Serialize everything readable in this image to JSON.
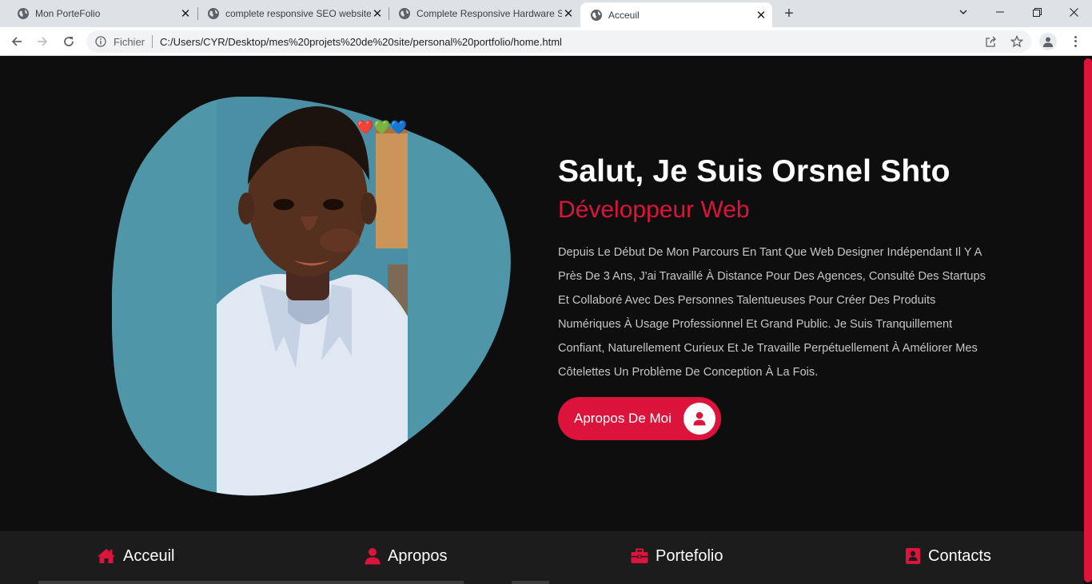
{
  "browser": {
    "tabs": [
      {
        "title": "Mon PorteFolio"
      },
      {
        "title": "complete responsive SEO website"
      },
      {
        "title": "Complete Responsive Hardware Store"
      },
      {
        "title": "Acceuil"
      }
    ],
    "address": {
      "protocol_label": "Fichier",
      "url": "C:/Users/CYR/Desktop/mes%20projets%20de%20site/personal%20portfolio/home.html"
    }
  },
  "hero": {
    "title": "Salut, Je Suis Orsnel Shto",
    "subtitle": "Développeur Web",
    "description": "Depuis Le Début De Mon Parcours En Tant Que Web Designer Indépendant Il Y A Près De 3 Ans, J'ai Travaillé À Distance Pour Des Agences, Consulté Des Startups Et Collaboré Avec Des Personnes Talentueuses Pour Créer Des Produits Numériques À Usage Professionnel Et Grand Public. Je Suis Tranquillement Confiant, Naturellement Curieux Et Je Travaille Perpétuellement À Améliorer Mes Côtelettes Un Problème De Conception À La Fois.",
    "button_label": "Apropos De Moi",
    "photo_emoji": "❤️💚💙"
  },
  "nav": {
    "home": "Acceuil",
    "about": "Apropos",
    "portfolio": "Portefolio",
    "contacts": "Contacts"
  },
  "colors": {
    "accent": "#dc143c",
    "background": "#0e0e0f",
    "nav_background": "#1c1c1d",
    "blob": "#4f96a9"
  },
  "icons": {
    "button": "user-icon",
    "home": "home-icon",
    "about": "user-icon",
    "portfolio": "briefcase-icon",
    "contacts": "address-card-icon"
  }
}
